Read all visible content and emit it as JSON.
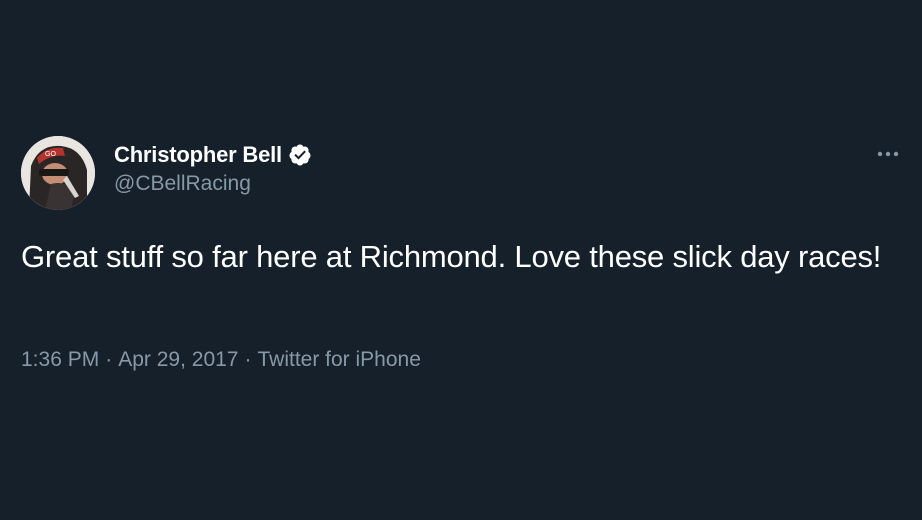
{
  "tweet": {
    "author": {
      "display_name": "Christopher Bell",
      "handle": "@CBellRacing",
      "verified_icon": "verified-badge-icon",
      "avatar_icon": "profile-photo"
    },
    "text": "Great stuff so far here at Richmond. Love these slick day races!",
    "time": "1:36 PM",
    "date": "Apr 29, 2017",
    "separator": "·",
    "source": "Twitter for iPhone",
    "more_icon": "more-options-icon"
  },
  "colors": {
    "background": "#15202b",
    "primary_text": "#ffffff",
    "secondary_text": "#8899a6"
  }
}
